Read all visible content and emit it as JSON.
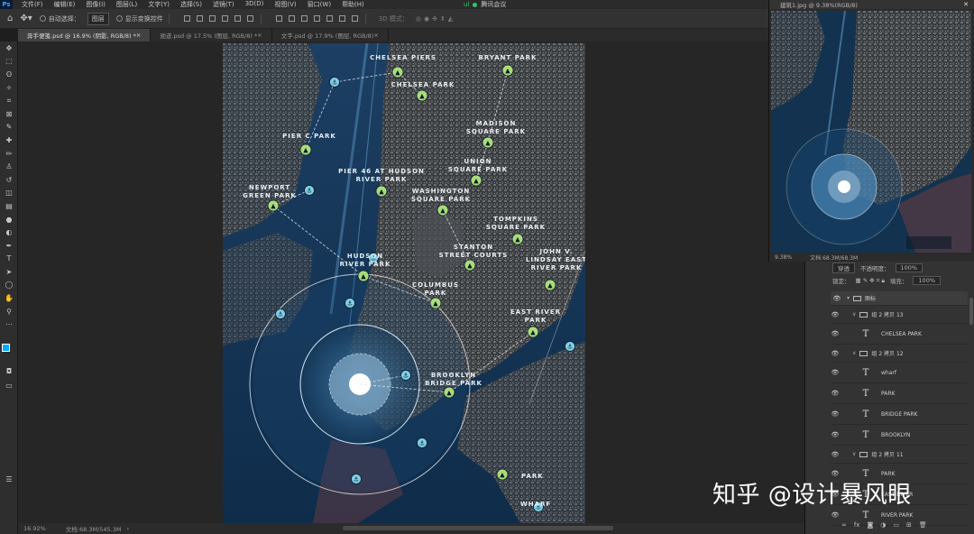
{
  "menubar": {
    "app": "Ps",
    "items": [
      "文件(F)",
      "编辑(E)",
      "图像(I)",
      "图层(L)",
      "文字(Y)",
      "选择(S)",
      "滤镜(T)",
      "3D(D)",
      "视图(V)",
      "窗口(W)",
      "帮助(H)"
    ],
    "meeting_label": "腾讯会议",
    "meeting_num": "ul"
  },
  "options": {
    "auto_select": "自动选择：",
    "target": "图层",
    "show_transform": "显示变换控件",
    "mode_3d": "3D 模式："
  },
  "tabs": [
    {
      "label": "奔手便笺.psd @ 16.9% (阴影, RGB/8) *",
      "active": true
    },
    {
      "label": "勋迹.psd @ 17.5% (图层, RGB/8) *",
      "active": false
    },
    {
      "label": "文字.psd @ 17.9% (图层, RGB/8)",
      "active": false
    }
  ],
  "tools": [
    "move-icon",
    "marquee-icon",
    "lasso-icon",
    "magic-wand-icon",
    "crop-icon",
    "frame-icon",
    "eyedropper-icon",
    "healing-icon",
    "brush-icon",
    "stamp-icon",
    "history-brush-icon",
    "eraser-icon",
    "gradient-icon",
    "blur-icon",
    "dodge-icon",
    "pen-icon",
    "type-icon",
    "path-select-icon",
    "shape-icon",
    "hand-icon",
    "zoom-icon",
    "more-icon"
  ],
  "tool_glyphs": [
    "✥",
    "⬚",
    "ʘ",
    "✧",
    "⌗",
    "⊠",
    "✎",
    "✚",
    "✏",
    "♙",
    "↺",
    "◫",
    "▤",
    "●",
    "◐",
    "✒",
    "T",
    "➤",
    "◯",
    "✋",
    "⚲",
    "⋯"
  ],
  "colors": {
    "foreground": "#00a8ff",
    "background": "#ffffff",
    "pin_green": "#a9dc7a",
    "pin_blue": "#7fcfe8"
  },
  "status": {
    "zoom": "16.92%",
    "doc": "文档:68.3M/545.3M"
  },
  "navigator": {
    "title": "建筑1.jpg @ 9.38%(RGB/8)",
    "zoom": "9.38%",
    "doc": "文档:68.3M/68.3M"
  },
  "layers_panel": {
    "mode": "穿透",
    "opacity_label": "不透明度：",
    "opacity": "100%",
    "lock_label": "锁定：",
    "fill_label": "填充：",
    "fill": "100%",
    "items": [
      {
        "kind": "group1",
        "name": "图标",
        "selected": true
      },
      {
        "kind": "group2",
        "name": "组 2 拷贝 13"
      },
      {
        "kind": "text",
        "name": "CHELSEA PARK"
      },
      {
        "kind": "group2",
        "name": "组 2 拷贝 12"
      },
      {
        "kind": "text",
        "name": "wharf"
      },
      {
        "kind": "text",
        "name": "PARK"
      },
      {
        "kind": "text",
        "name": "BRIDGE PARK"
      },
      {
        "kind": "text",
        "name": "BROOKLYN"
      },
      {
        "kind": "group2",
        "name": "组 2 拷贝 11"
      },
      {
        "kind": "text",
        "name": "PARK"
      },
      {
        "kind": "text",
        "name": "EAST RIVER"
      },
      {
        "kind": "text",
        "name": "RIVER PARK"
      }
    ]
  },
  "map_labels": [
    {
      "id": "chelsea-piers",
      "lines": [
        "CHELSEA PIERS"
      ]
    },
    {
      "id": "bryant-park",
      "lines": [
        "BRYANT PARK"
      ]
    },
    {
      "id": "chelsea-park",
      "lines": [
        "CHELSEA PARK"
      ]
    },
    {
      "id": "madison-square-park",
      "lines": [
        "MADISON",
        "SQUARE PARK"
      ]
    },
    {
      "id": "pier-c-park",
      "lines": [
        "PIER C PARK"
      ]
    },
    {
      "id": "union-square-park",
      "lines": [
        "UNION",
        "SQUARE PARK"
      ]
    },
    {
      "id": "pier-46",
      "lines": [
        "PIER 46 AT HUDSON",
        "RIVER PARK"
      ]
    },
    {
      "id": "newport-green-park",
      "lines": [
        "NEWPORT",
        "GREEN PARK"
      ]
    },
    {
      "id": "washington-square-park",
      "lines": [
        "WASHINGTON",
        "SQUARE PARK"
      ]
    },
    {
      "id": "tompkins-square-park",
      "lines": [
        "TOMPKINS",
        "SQUARE PARK"
      ]
    },
    {
      "id": "stanton-street-courts",
      "lines": [
        "STANTON",
        "STREET COURTS"
      ]
    },
    {
      "id": "john-v-lindsay",
      "lines": [
        "JOHN V.",
        "LINDSAY EAST",
        "RIVER PARK"
      ]
    },
    {
      "id": "hudson-river-park",
      "lines": [
        "HUDSON",
        "RIVER PARK"
      ]
    },
    {
      "id": "columbus-park",
      "lines": [
        "COLUMBUS",
        "PARK"
      ]
    },
    {
      "id": "east-river-park",
      "lines": [
        "EAST RIVER",
        "PARK"
      ]
    },
    {
      "id": "brooklyn-bridge-park",
      "lines": [
        "BROOKLYN",
        "BRIDGE PARK"
      ]
    },
    {
      "id": "legend-park",
      "lines": [
        "PARK"
      ]
    },
    {
      "id": "legend-wharf",
      "lines": [
        "WHARF"
      ]
    }
  ],
  "watermark": "知乎 @设计暴风眼"
}
